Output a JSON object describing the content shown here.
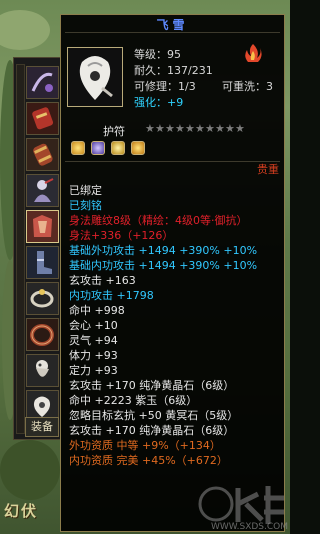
{
  "scene": {
    "banner_text": "幻伏"
  },
  "strip": {
    "equip_tab_label": "装备"
  },
  "tooltip": {
    "title": "飞雪",
    "level": "等级：95",
    "durability": "耐久：137/231",
    "repairable": "可修理：1/3",
    "rewashable": "可重洗：3",
    "enhance": "强化：+9",
    "charm_label": "护符",
    "charm_stars_total": 10,
    "precious_label": "贵重",
    "lines": [
      {
        "text": "已绑定",
        "color": "#e6e6e6"
      },
      {
        "text": "已刻铭",
        "color": "#31c8ff"
      },
      {
        "text": "身法雕纹8级（精绘：4级0等·御抗）",
        "color": "#e0202a"
      },
      {
        "text": "身法+336（+126）",
        "color": "#e0202a"
      },
      {
        "text": "基础外功攻击 +1494 +390% +10%",
        "color": "#31c8ff"
      },
      {
        "text": "基础内功攻击 +1494 +390% +10%",
        "color": "#31c8ff"
      },
      {
        "text": "玄攻击 +163",
        "color": "#e6e6e6"
      },
      {
        "text": "内功攻击 +1798",
        "color": "#31c8ff"
      },
      {
        "text": "命中 +998",
        "color": "#e6e6e6"
      },
      {
        "text": "会心 +10",
        "color": "#e6e6e6"
      },
      {
        "text": "灵气 +94",
        "color": "#e6e6e6"
      },
      {
        "text": "体力 +93",
        "color": "#e6e6e6"
      },
      {
        "text": "定力 +93",
        "color": "#e6e6e6"
      },
      {
        "text": "玄攻击 +170  纯净黄晶石（6级）",
        "color": "#e6e6e6"
      },
      {
        "text": "命中 +2223  紫玉（6级）",
        "color": "#e6e6e6"
      },
      {
        "text": "忽略目标玄抗 +50  黄冥石（5级）",
        "color": "#e6e6e6"
      },
      {
        "text": "玄攻击 +170  纯净黄晶石（6级）",
        "color": "#e6e6e6"
      },
      {
        "text": "外功资质  中等 +9%（+134）",
        "color": "#e06a20"
      },
      {
        "text": "内功资质  完美 +45%（+672）",
        "color": "#e06a20"
      }
    ]
  },
  "watermark": {
    "text": "WWW.SXDS.COM"
  },
  "colors": {
    "title": "#5e89ff",
    "enhance": "#2fd3ff",
    "precious": "#d33e1f",
    "border": "#8c7d4c"
  }
}
